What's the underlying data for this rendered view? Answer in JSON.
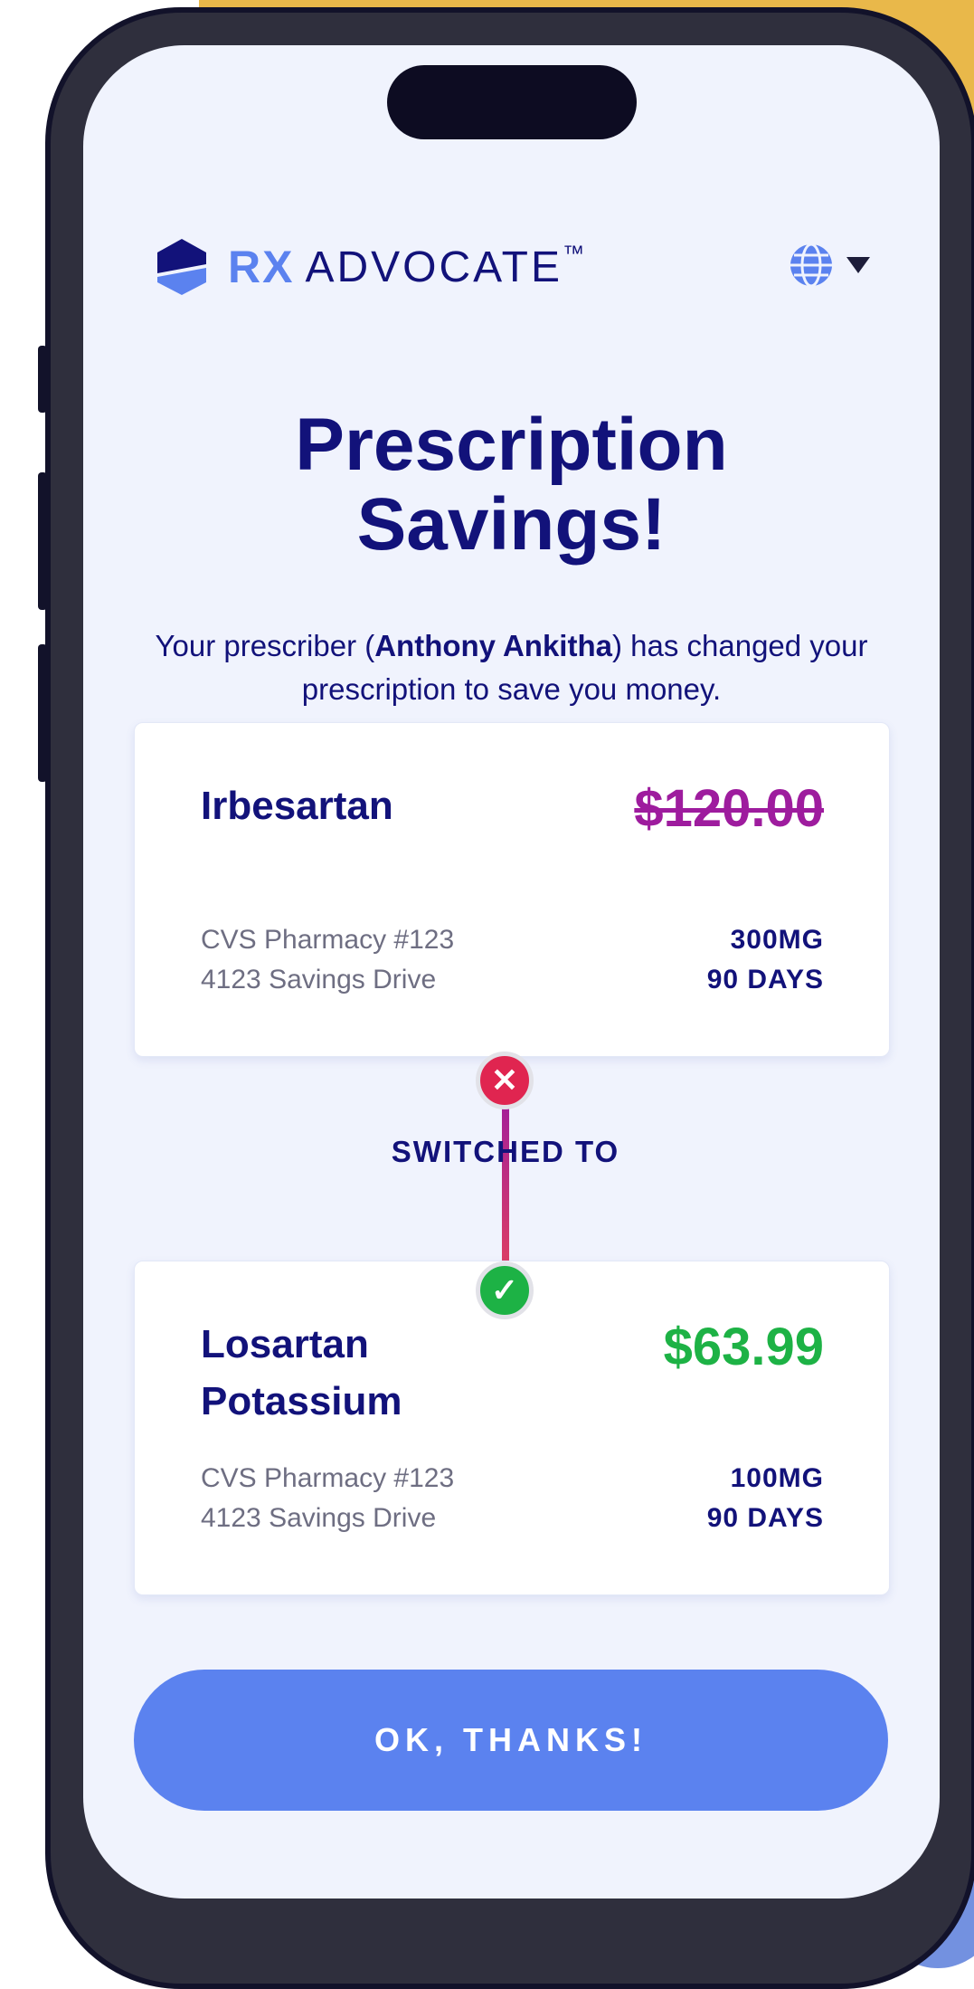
{
  "brand": {
    "rx": "RX",
    "name": "ADVOCATE",
    "tm": "™"
  },
  "language_selector": {
    "icon": "globe-icon"
  },
  "header": {
    "title_line1": "Prescription",
    "title_line2": "Savings!"
  },
  "message": {
    "prefix": "Your prescriber (",
    "prescriber": "Anthony Ankitha",
    "suffix": ") has changed your prescription to save you money."
  },
  "original_rx": {
    "drug": "Irbesartan",
    "price": "$120.00",
    "pharmacy": "CVS Pharmacy #123",
    "address": "4123 Savings Drive",
    "dose": "300MG",
    "supply": "90 DAYS"
  },
  "switch_label": "SWITCHED TO",
  "new_rx": {
    "drug": "Losartan Potassium",
    "price": "$63.99",
    "pharmacy": "CVS Pharmacy #123",
    "address": "4123 Savings Drive",
    "dose": "100MG",
    "supply": "90 DAYS"
  },
  "actions": {
    "ok_label": "OK, THANKS!"
  },
  "colors": {
    "brand_navy": "#12127A",
    "accent_blue": "#5B82EF",
    "old_price": "#9E1C9E",
    "new_price": "#1DB245",
    "remove_badge": "#E02550"
  }
}
